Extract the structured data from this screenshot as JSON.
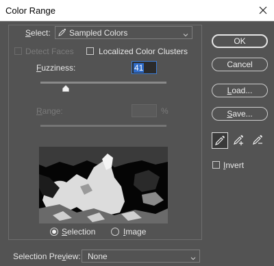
{
  "window": {
    "title": "Color Range"
  },
  "select": {
    "label": "Select:",
    "value": "Sampled Colors"
  },
  "options": {
    "detect_faces": "Detect Faces",
    "localized_color_clusters": "Localized Color Clusters"
  },
  "fuzziness": {
    "label": "Fuzziness:",
    "value": "41",
    "level_fraction": 0.2
  },
  "range": {
    "label": "Range:",
    "value": "",
    "unit": "%"
  },
  "preview_mode": {
    "selection_label": "Selection",
    "image_label": "Image",
    "selected": "Selection"
  },
  "buttons": {
    "ok": "OK",
    "cancel": "Cancel",
    "load": "Load...",
    "save": "Save..."
  },
  "invert": {
    "label": "Invert"
  },
  "selection_preview": {
    "label": "Selection Preview:",
    "value": "None"
  },
  "icons": [
    "eyedropper-icon",
    "eyedropper-plus-icon",
    "eyedropper-minus-icon",
    "close-icon",
    "chevron-down-icon"
  ]
}
